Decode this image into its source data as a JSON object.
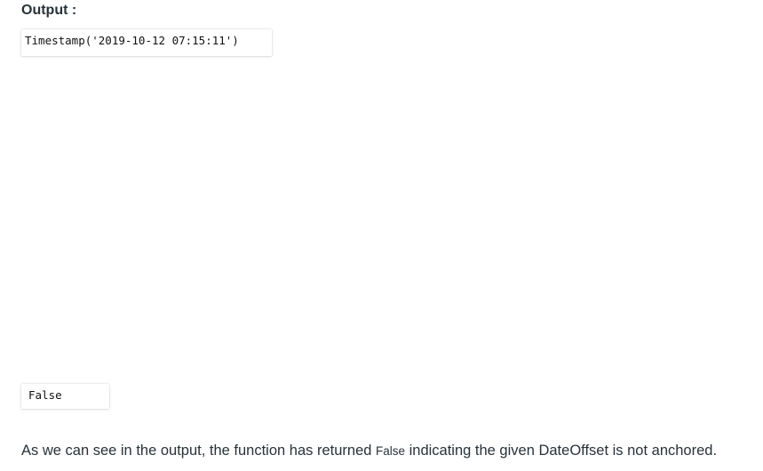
{
  "heading": "Output :",
  "output1": "Timestamp('2019-10-12 07:15:11')",
  "output2": "False",
  "paragraph": {
    "before": "As we can see in the output, the function has returned ",
    "code": "False",
    "after": " indicating the given DateOffset is not anchored."
  }
}
